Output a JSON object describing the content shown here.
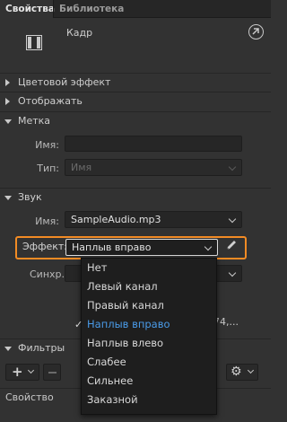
{
  "tabs": {
    "properties": "Свойства",
    "library": "Библиотека"
  },
  "object": {
    "type_label": "Кадр"
  },
  "sections": {
    "color_effect": "Цветовой эффект",
    "display": "Отображать",
    "label": "Метка",
    "sound": "Звук",
    "filters": "Фильтры"
  },
  "label_section": {
    "name_label": "Имя:",
    "name_value": "",
    "type_label": "Тип:",
    "type_value": "Имя"
  },
  "sound_section": {
    "name_label": "Имя:",
    "name_value": "SampleAudio.mp3",
    "effect_label": "Эффект:",
    "effect_value": "Наплыв вправо",
    "sync_label": "Синхр.:",
    "info_fragment": "74,..."
  },
  "effect_options": [
    {
      "label": "Нет",
      "selected": false
    },
    {
      "label": "Левый канал",
      "selected": false
    },
    {
      "label": "Правый канал",
      "selected": false
    },
    {
      "label": "Наплыв вправо",
      "selected": true
    },
    {
      "label": "Наплыв влево",
      "selected": false
    },
    {
      "label": "Слабее",
      "selected": false
    },
    {
      "label": "Сильнее",
      "selected": false
    },
    {
      "label": "Заказной",
      "selected": false
    }
  ],
  "filters_table": {
    "property_column": "Свойство"
  },
  "check_glyph": "✓",
  "colors": {
    "panel_bg": "#323232",
    "highlight": "#f28b24",
    "selected_item": "#4a9be8"
  }
}
